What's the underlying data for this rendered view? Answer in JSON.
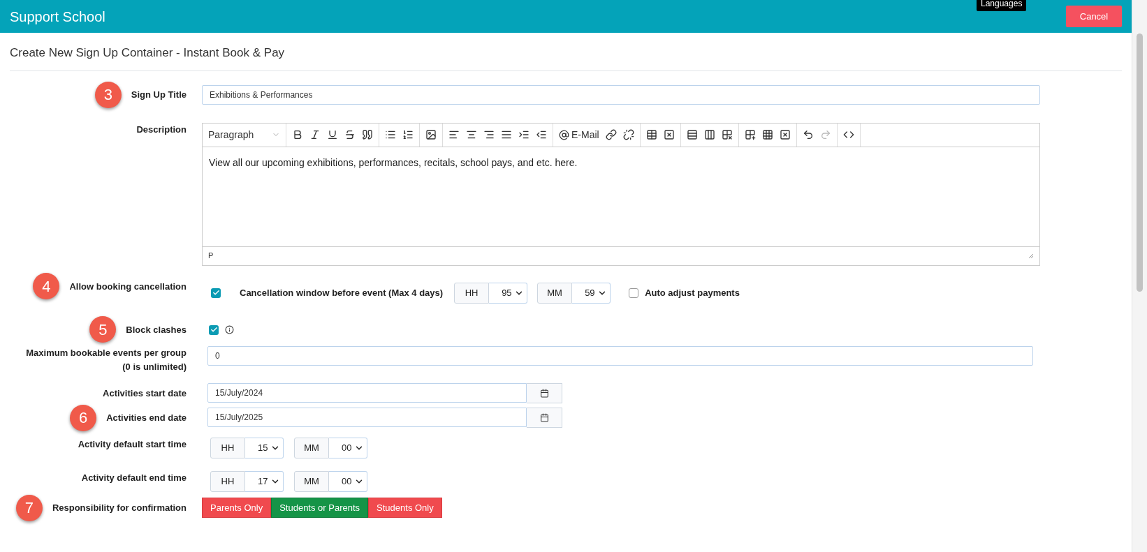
{
  "header": {
    "title": "Support School",
    "tooltip": "Languages",
    "cancel_button": "Cancel"
  },
  "page_title": "Create New Sign Up Container - Instant Book & Pay",
  "sign_up_title": {
    "step": "3",
    "label": "Sign Up Title",
    "value": "Exhibitions & Performances"
  },
  "description": {
    "label": "Description",
    "format": "Paragraph",
    "email_button": "E-Mail",
    "content": "View all our upcoming exhibitions, performances, recitals, school pays, and etc. here.",
    "status": "P"
  },
  "cancellation": {
    "step": "4",
    "label": "Allow booking cancellation",
    "checked": true,
    "window_label": "Cancellation window before event (Max 4 days)",
    "hours": {
      "unit": "HH",
      "value": "95"
    },
    "minutes": {
      "unit": "MM",
      "value": "59"
    },
    "auto_adjust": {
      "label": "Auto adjust payments",
      "checked": false
    }
  },
  "block_clashes": {
    "step": "5",
    "label": "Block clashes",
    "checked": true
  },
  "max_events": {
    "label": "Maximum bookable events per group",
    "sublabel": "(0 is unlimited)",
    "value": "0"
  },
  "start_date": {
    "label": "Activities start date",
    "value": "15/July/2024"
  },
  "end_date": {
    "step": "6",
    "label": "Activities end date",
    "value": "15/July/2025"
  },
  "start_time": {
    "label": "Activity default start time",
    "hours": {
      "unit": "HH",
      "value": "15"
    },
    "minutes": {
      "unit": "MM",
      "value": "00"
    }
  },
  "end_time": {
    "label": "Activity default end time",
    "hours": {
      "unit": "HH",
      "value": "17"
    },
    "minutes": {
      "unit": "MM",
      "value": "00"
    }
  },
  "responsibility": {
    "step": "7",
    "label": "Responsibility for confirmation",
    "options": [
      {
        "label": "Parents Only",
        "selected": false
      },
      {
        "label": "Students or Parents",
        "selected": true
      },
      {
        "label": "Students Only",
        "selected": false
      }
    ]
  }
}
